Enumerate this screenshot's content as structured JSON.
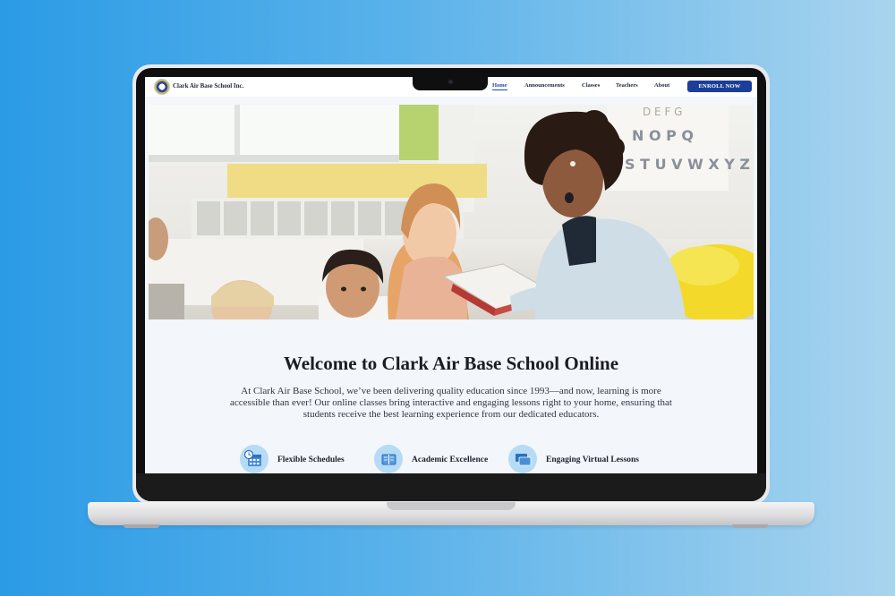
{
  "site": {
    "brand_name": "Clark Air Base School Inc.",
    "logo_icon": "school-seal-logo"
  },
  "nav": {
    "links": [
      {
        "label": "Home",
        "active": true
      },
      {
        "label": "Announcements",
        "active": false
      },
      {
        "label": "Classes",
        "active": false
      },
      {
        "label": "Teachers",
        "active": false
      },
      {
        "label": "About",
        "active": false
      }
    ],
    "cta_label": "ENROLL NOW",
    "cta_color": "#1b3f99"
  },
  "hero": {
    "image_icon": "teacher-reading-to-children-photo",
    "carousel_dots": 4,
    "active_dot": 0,
    "poster_letters": [
      "N",
      "O",
      "P",
      "Q",
      "S",
      "T",
      "U",
      "V",
      "W",
      "X",
      "Y",
      "Z"
    ]
  },
  "welcome": {
    "title": "Welcome to Clark Air Base School Online",
    "text": "At Clark Air Base School, we’ve been delivering quality education since 1993—and now, learning is more accessible than ever! Our online classes bring interactive and engaging lessons right to your home, ensuring that students receive the best learning experience from our dedicated educators."
  },
  "features": [
    {
      "label": "Flexible Schedules",
      "icon": "calendar-clock-icon"
    },
    {
      "label": "Academic Excellence",
      "icon": "book-icon"
    },
    {
      "label": "Engaging Virtual Lessons",
      "icon": "video-windows-icon"
    }
  ],
  "colors": {
    "background_left": "#2b9be6",
    "background_right": "#a9d4ee",
    "accent": "#1d49b0"
  }
}
